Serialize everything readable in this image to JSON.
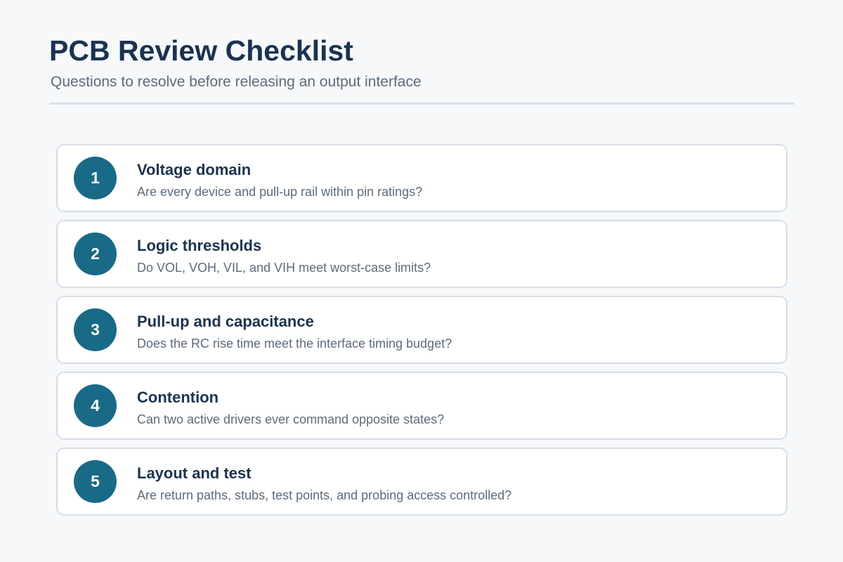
{
  "header": {
    "title": "PCB Review Checklist",
    "subtitle": "Questions to resolve before releasing an output interface"
  },
  "items": [
    {
      "number": "1",
      "title": "Voltage domain",
      "description": "Are every device and pull-up rail within pin ratings?"
    },
    {
      "number": "2",
      "title": "Logic thresholds",
      "description": "Do VOL, VOH, VIL, and VIH meet worst-case limits?"
    },
    {
      "number": "3",
      "title": "Pull-up and capacitance",
      "description": "Does the RC rise time meet the interface timing budget?"
    },
    {
      "number": "4",
      "title": "Contention",
      "description": "Can two active drivers ever command opposite states?"
    },
    {
      "number": "5",
      "title": "Layout and test",
      "description": "Are return paths, stubs, test points, and probing access controlled?"
    }
  ],
  "colors": {
    "background": "#f6f8fa",
    "title": "#1a3350",
    "muted_text": "#5d6b7a",
    "badge": "#186a87",
    "card_border": "#d7dee6"
  }
}
